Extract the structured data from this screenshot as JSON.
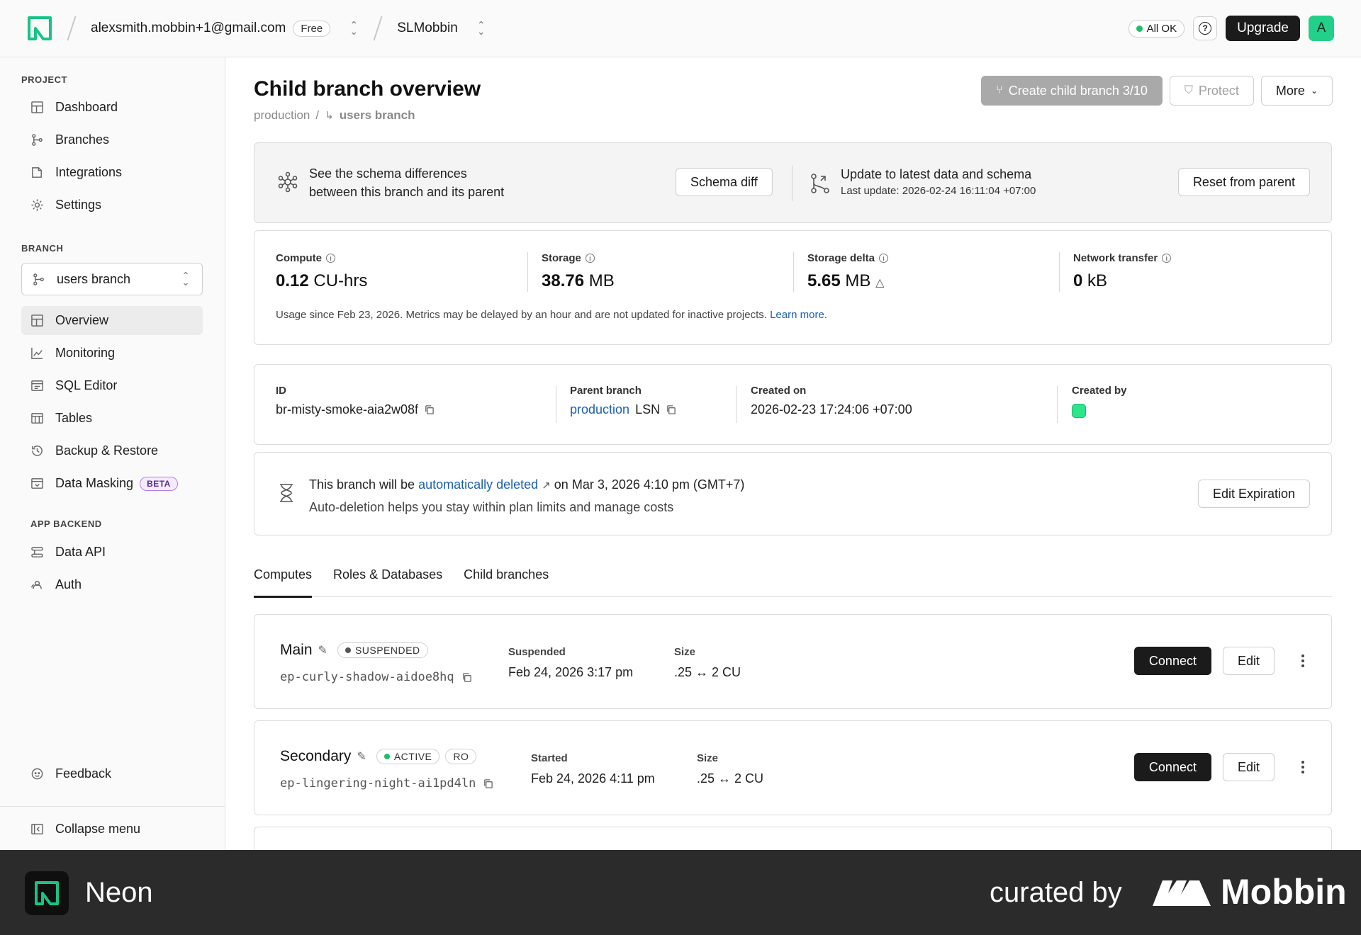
{
  "topbar": {
    "account": "alexsmith.mobbin+1@gmail.com",
    "plan": "Free",
    "project": "SLMobbin",
    "status": "All OK",
    "upgrade": "Upgrade",
    "avatar": "A"
  },
  "sidebar": {
    "project_title": "PROJECT",
    "project_items": [
      {
        "label": "Dashboard",
        "icon": "dashboard-icon"
      },
      {
        "label": "Branches",
        "icon": "branches-icon"
      },
      {
        "label": "Integrations",
        "icon": "integrations-icon"
      },
      {
        "label": "Settings",
        "icon": "gear-icon"
      }
    ],
    "branch_title": "BRANCH",
    "branch_selected": "users branch",
    "branch_items": [
      {
        "label": "Overview",
        "icon": "overview-icon",
        "active": true
      },
      {
        "label": "Monitoring",
        "icon": "monitoring-icon"
      },
      {
        "label": "SQL Editor",
        "icon": "sql-editor-icon"
      },
      {
        "label": "Tables",
        "icon": "tables-icon"
      },
      {
        "label": "Backup & Restore",
        "icon": "backup-icon"
      },
      {
        "label": "Data Masking",
        "icon": "data-masking-icon",
        "badge": "BETA"
      }
    ],
    "app_backend_title": "APP BACKEND",
    "app_backend_items": [
      {
        "label": "Data API",
        "icon": "data-api-icon"
      },
      {
        "label": "Auth",
        "icon": "auth-icon"
      }
    ],
    "feedback": "Feedback",
    "collapse": "Collapse menu"
  },
  "header": {
    "title": "Child branch overview",
    "breadcrumb_parent": "production",
    "breadcrumb_sep": "/",
    "breadcrumb_current": "users branch",
    "create_child": "Create child branch 3/10",
    "protect": "Protect",
    "more": "More"
  },
  "schema": {
    "line1": "See the schema differences",
    "line2": "between this branch and its parent",
    "diff_button": "Schema diff",
    "update_title": "Update to latest data and schema",
    "update_sub": "Last update: 2026-02-24 16:11:04 +07:00",
    "reset_button": "Reset from parent"
  },
  "metrics": {
    "compute_label": "Compute",
    "compute_value": "0.12",
    "compute_unit": "CU-hrs",
    "storage_label": "Storage",
    "storage_value": "38.76",
    "storage_unit": "MB",
    "delta_label": "Storage delta",
    "delta_value": "5.65",
    "delta_unit": "MB",
    "network_label": "Network transfer",
    "network_value": "0",
    "network_unit": "kB",
    "note": "Usage since Feb 23, 2026. Metrics may be delayed by an hour and are not updated for inactive projects.",
    "learn_more": "Learn more."
  },
  "details": {
    "id_label": "ID",
    "id_value": "br-misty-smoke-aia2w08f",
    "parent_label": "Parent branch",
    "parent_value": "production",
    "parent_lsn": "LSN",
    "created_label": "Created on",
    "created_value": "2026-02-23 17:24:06 +07:00",
    "created_by_label": "Created by"
  },
  "expiration": {
    "prefix": "This branch will be",
    "link": "automatically deleted",
    "suffix": "on Mar 3, 2026 4:10 pm (GMT+7)",
    "sub": "Auto-deletion helps you stay within plan limits and manage costs",
    "button": "Edit Expiration"
  },
  "tabs": [
    "Computes",
    "Roles & Databases",
    "Child branches"
  ],
  "computes": [
    {
      "name": "Main",
      "status": "SUSPENDED",
      "endpoint": "ep-curly-shadow-aidoe8hq",
      "time_label": "Suspended",
      "time_value": "Feb 24, 2026 3:17 pm",
      "size_label": "Size",
      "size_value": ".25 ↔ 2 CU",
      "connect": "Connect",
      "edit": "Edit"
    },
    {
      "name": "Secondary",
      "status": "ACTIVE",
      "badge": "RO",
      "endpoint": "ep-lingering-night-ai1pd4ln",
      "time_label": "Started",
      "time_value": "Feb 24, 2026 4:11 pm",
      "size_label": "Size",
      "size_value": ".25 ↔ 2 CU",
      "connect": "Connect",
      "edit": "Edit"
    }
  ],
  "footer": {
    "brand": "Neon",
    "curated": "curated by",
    "mobbin": "Mobbin"
  },
  "colors": {
    "brand_green": "#22d08a",
    "link_blue": "#1d5fae",
    "status_green": "#1fbf6b"
  }
}
